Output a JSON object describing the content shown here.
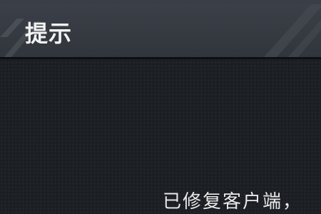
{
  "dialog": {
    "title": "提示",
    "message": "已修复客户端，"
  }
}
